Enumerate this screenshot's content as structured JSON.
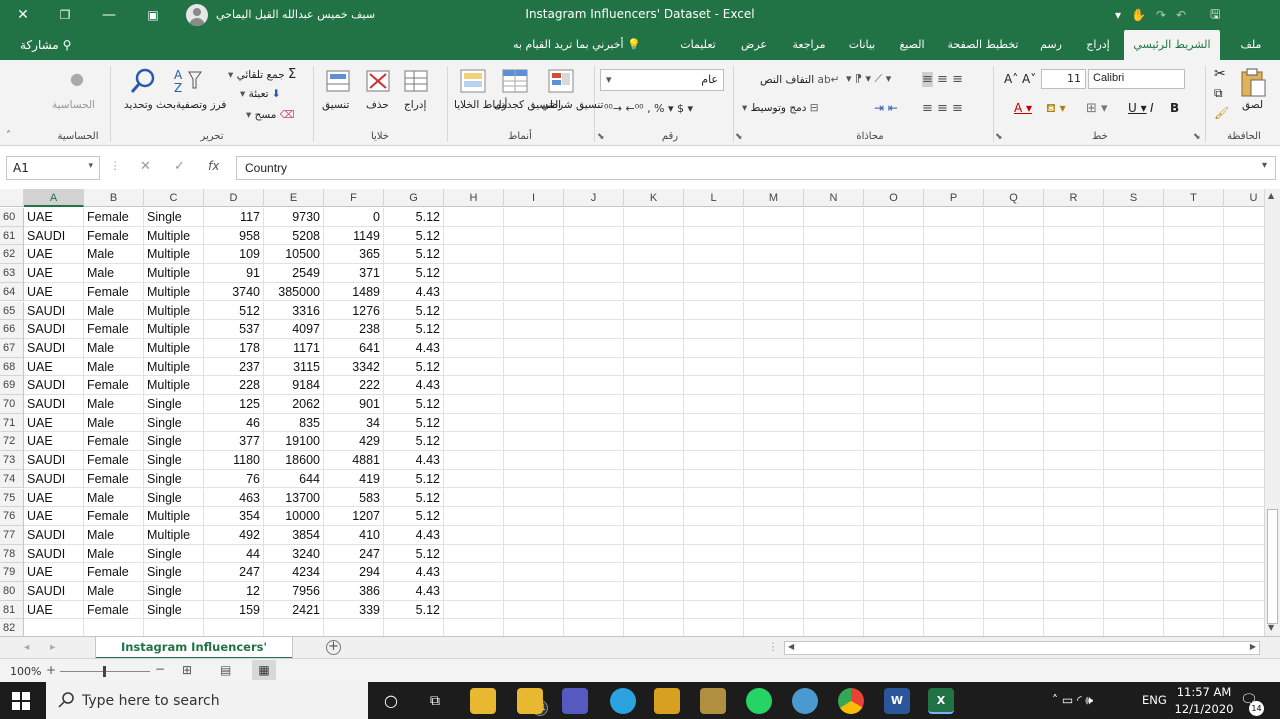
{
  "window": {
    "title": "Instagram Influencers' Dataset  -  Excel",
    "user_name": "سيف خميس عبدالله القيل اليماحي"
  },
  "tell_me": "أخبرني بما تريد القيام به",
  "share_label": "مشاركة",
  "tabs": [
    {
      "label": "ملف"
    },
    {
      "label": "الشريط الرئيسي"
    },
    {
      "label": "إدراج"
    },
    {
      "label": "رسم"
    },
    {
      "label": "تخطيط الصفحة"
    },
    {
      "label": "الصيغ"
    },
    {
      "label": "بيانات"
    },
    {
      "label": "مراجعة"
    },
    {
      "label": "عرض"
    },
    {
      "label": "تعليمات"
    }
  ],
  "ribbon": {
    "clipboard": {
      "label": "الحافظة",
      "paste": "لصق"
    },
    "font": {
      "label": "خط",
      "name": "Calibri",
      "size": "11"
    },
    "alignment": {
      "label": "محاذاة",
      "wrap": "التفاف النص",
      "merge": "دمج وتوسيط"
    },
    "number": {
      "label": "رقم",
      "format": "عام"
    },
    "styles": {
      "label": "أنماط",
      "conditional": "تنسيق شرطي",
      "format_table": "التنسيق كجدول",
      "cell_styles": "أنماط الخلايا"
    },
    "cells": {
      "label": "خلايا",
      "insert": "إدراج",
      "delete": "حذف",
      "format": "تنسيق"
    },
    "editing": {
      "label": "تحرير",
      "autosum": "جمع تلقائي",
      "fill": "تعبئة",
      "clear": "مسح",
      "sort": "فرز وتصفية",
      "find": "بحث وتحديد"
    },
    "sensitivity": {
      "label": "الحساسية",
      "button": "الحساسية"
    }
  },
  "formula_bar": {
    "name_box": "A1",
    "fx": "fx",
    "formula": "Country"
  },
  "columns": [
    "A",
    "B",
    "C",
    "D",
    "E",
    "F",
    "G",
    "H",
    "I",
    "J",
    "K",
    "L",
    "M",
    "N",
    "O",
    "P",
    "Q",
    "R",
    "S",
    "T",
    "U"
  ],
  "rows": [
    {
      "n": "60",
      "a": "UAE",
      "b": "Female",
      "c": "Single",
      "d": "117",
      "e": "9730",
      "f": "0",
      "g": "5.12"
    },
    {
      "n": "61",
      "a": "SAUDI",
      "b": "Female",
      "c": "Multiple",
      "d": "958",
      "e": "5208",
      "f": "1149",
      "g": "5.12"
    },
    {
      "n": "62",
      "a": "UAE",
      "b": "Male",
      "c": "Multiple",
      "d": "109",
      "e": "10500",
      "f": "365",
      "g": "5.12"
    },
    {
      "n": "63",
      "a": "UAE",
      "b": "Male",
      "c": "Multiple",
      "d": "91",
      "e": "2549",
      "f": "371",
      "g": "5.12"
    },
    {
      "n": "64",
      "a": "UAE",
      "b": "Female",
      "c": "Multiple",
      "d": "3740",
      "e": "385000",
      "f": "1489",
      "g": "4.43"
    },
    {
      "n": "65",
      "a": "SAUDI",
      "b": "Male",
      "c": "Multiple",
      "d": "512",
      "e": "3316",
      "f": "1276",
      "g": "5.12"
    },
    {
      "n": "66",
      "a": "SAUDI",
      "b": "Female",
      "c": "Multiple",
      "d": "537",
      "e": "4097",
      "f": "238",
      "g": "5.12"
    },
    {
      "n": "67",
      "a": "SAUDI",
      "b": "Male",
      "c": "Multiple",
      "d": "178",
      "e": "1171",
      "f": "641",
      "g": "4.43"
    },
    {
      "n": "68",
      "a": "UAE",
      "b": "Male",
      "c": "Multiple",
      "d": "237",
      "e": "3115",
      "f": "3342",
      "g": "5.12"
    },
    {
      "n": "69",
      "a": "SAUDI",
      "b": "Female",
      "c": "Multiple",
      "d": "228",
      "e": "9184",
      "f": "222",
      "g": "4.43"
    },
    {
      "n": "70",
      "a": "SAUDI",
      "b": "Male",
      "c": "Single",
      "d": "125",
      "e": "2062",
      "f": "901",
      "g": "5.12"
    },
    {
      "n": "71",
      "a": "UAE",
      "b": "Male",
      "c": "Single",
      "d": "46",
      "e": "835",
      "f": "34",
      "g": "5.12"
    },
    {
      "n": "72",
      "a": "UAE",
      "b": "Female",
      "c": "Single",
      "d": "377",
      "e": "19100",
      "f": "429",
      "g": "5.12"
    },
    {
      "n": "73",
      "a": "SAUDI",
      "b": "Female",
      "c": "Single",
      "d": "1180",
      "e": "18600",
      "f": "4881",
      "g": "4.43"
    },
    {
      "n": "74",
      "a": "SAUDI",
      "b": "Female",
      "c": "Single",
      "d": "76",
      "e": "644",
      "f": "419",
      "g": "5.12"
    },
    {
      "n": "75",
      "a": "UAE",
      "b": "Male",
      "c": "Single",
      "d": "463",
      "e": "13700",
      "f": "583",
      "g": "5.12"
    },
    {
      "n": "76",
      "a": "UAE",
      "b": "Female",
      "c": "Multiple",
      "d": "354",
      "e": "10000",
      "f": "1207",
      "g": "5.12"
    },
    {
      "n": "77",
      "a": "SAUDI",
      "b": "Male",
      "c": "Multiple",
      "d": "492",
      "e": "3854",
      "f": "410",
      "g": "4.43"
    },
    {
      "n": "78",
      "a": "SAUDI",
      "b": "Male",
      "c": "Single",
      "d": "44",
      "e": "3240",
      "f": "247",
      "g": "5.12"
    },
    {
      "n": "79",
      "a": "UAE",
      "b": "Female",
      "c": "Single",
      "d": "247",
      "e": "4234",
      "f": "294",
      "g": "4.43"
    },
    {
      "n": "80",
      "a": "SAUDI",
      "b": "Male",
      "c": "Single",
      "d": "12",
      "e": "7956",
      "f": "386",
      "g": "4.43"
    },
    {
      "n": "81",
      "a": "UAE",
      "b": "Female",
      "c": "Single",
      "d": "159",
      "e": "2421",
      "f": "339",
      "g": "5.12"
    },
    {
      "n": "82",
      "a": "",
      "b": "",
      "c": "",
      "d": "",
      "e": "",
      "f": "",
      "g": ""
    }
  ],
  "sheet_tab": "Instagram Influencers' Dataset",
  "status": {
    "zoom": "100%"
  },
  "taskbar": {
    "search_placeholder": "Type here to search",
    "time": "11:57 AM",
    "date": "12/1/2020",
    "language": "ENG",
    "explorer_badge": "11",
    "notification_count": "14"
  },
  "colors": {
    "excel_green": "#217346",
    "ribbon_bg": "#f3f3f3",
    "taskbar_bg": "#1c1c1c"
  }
}
